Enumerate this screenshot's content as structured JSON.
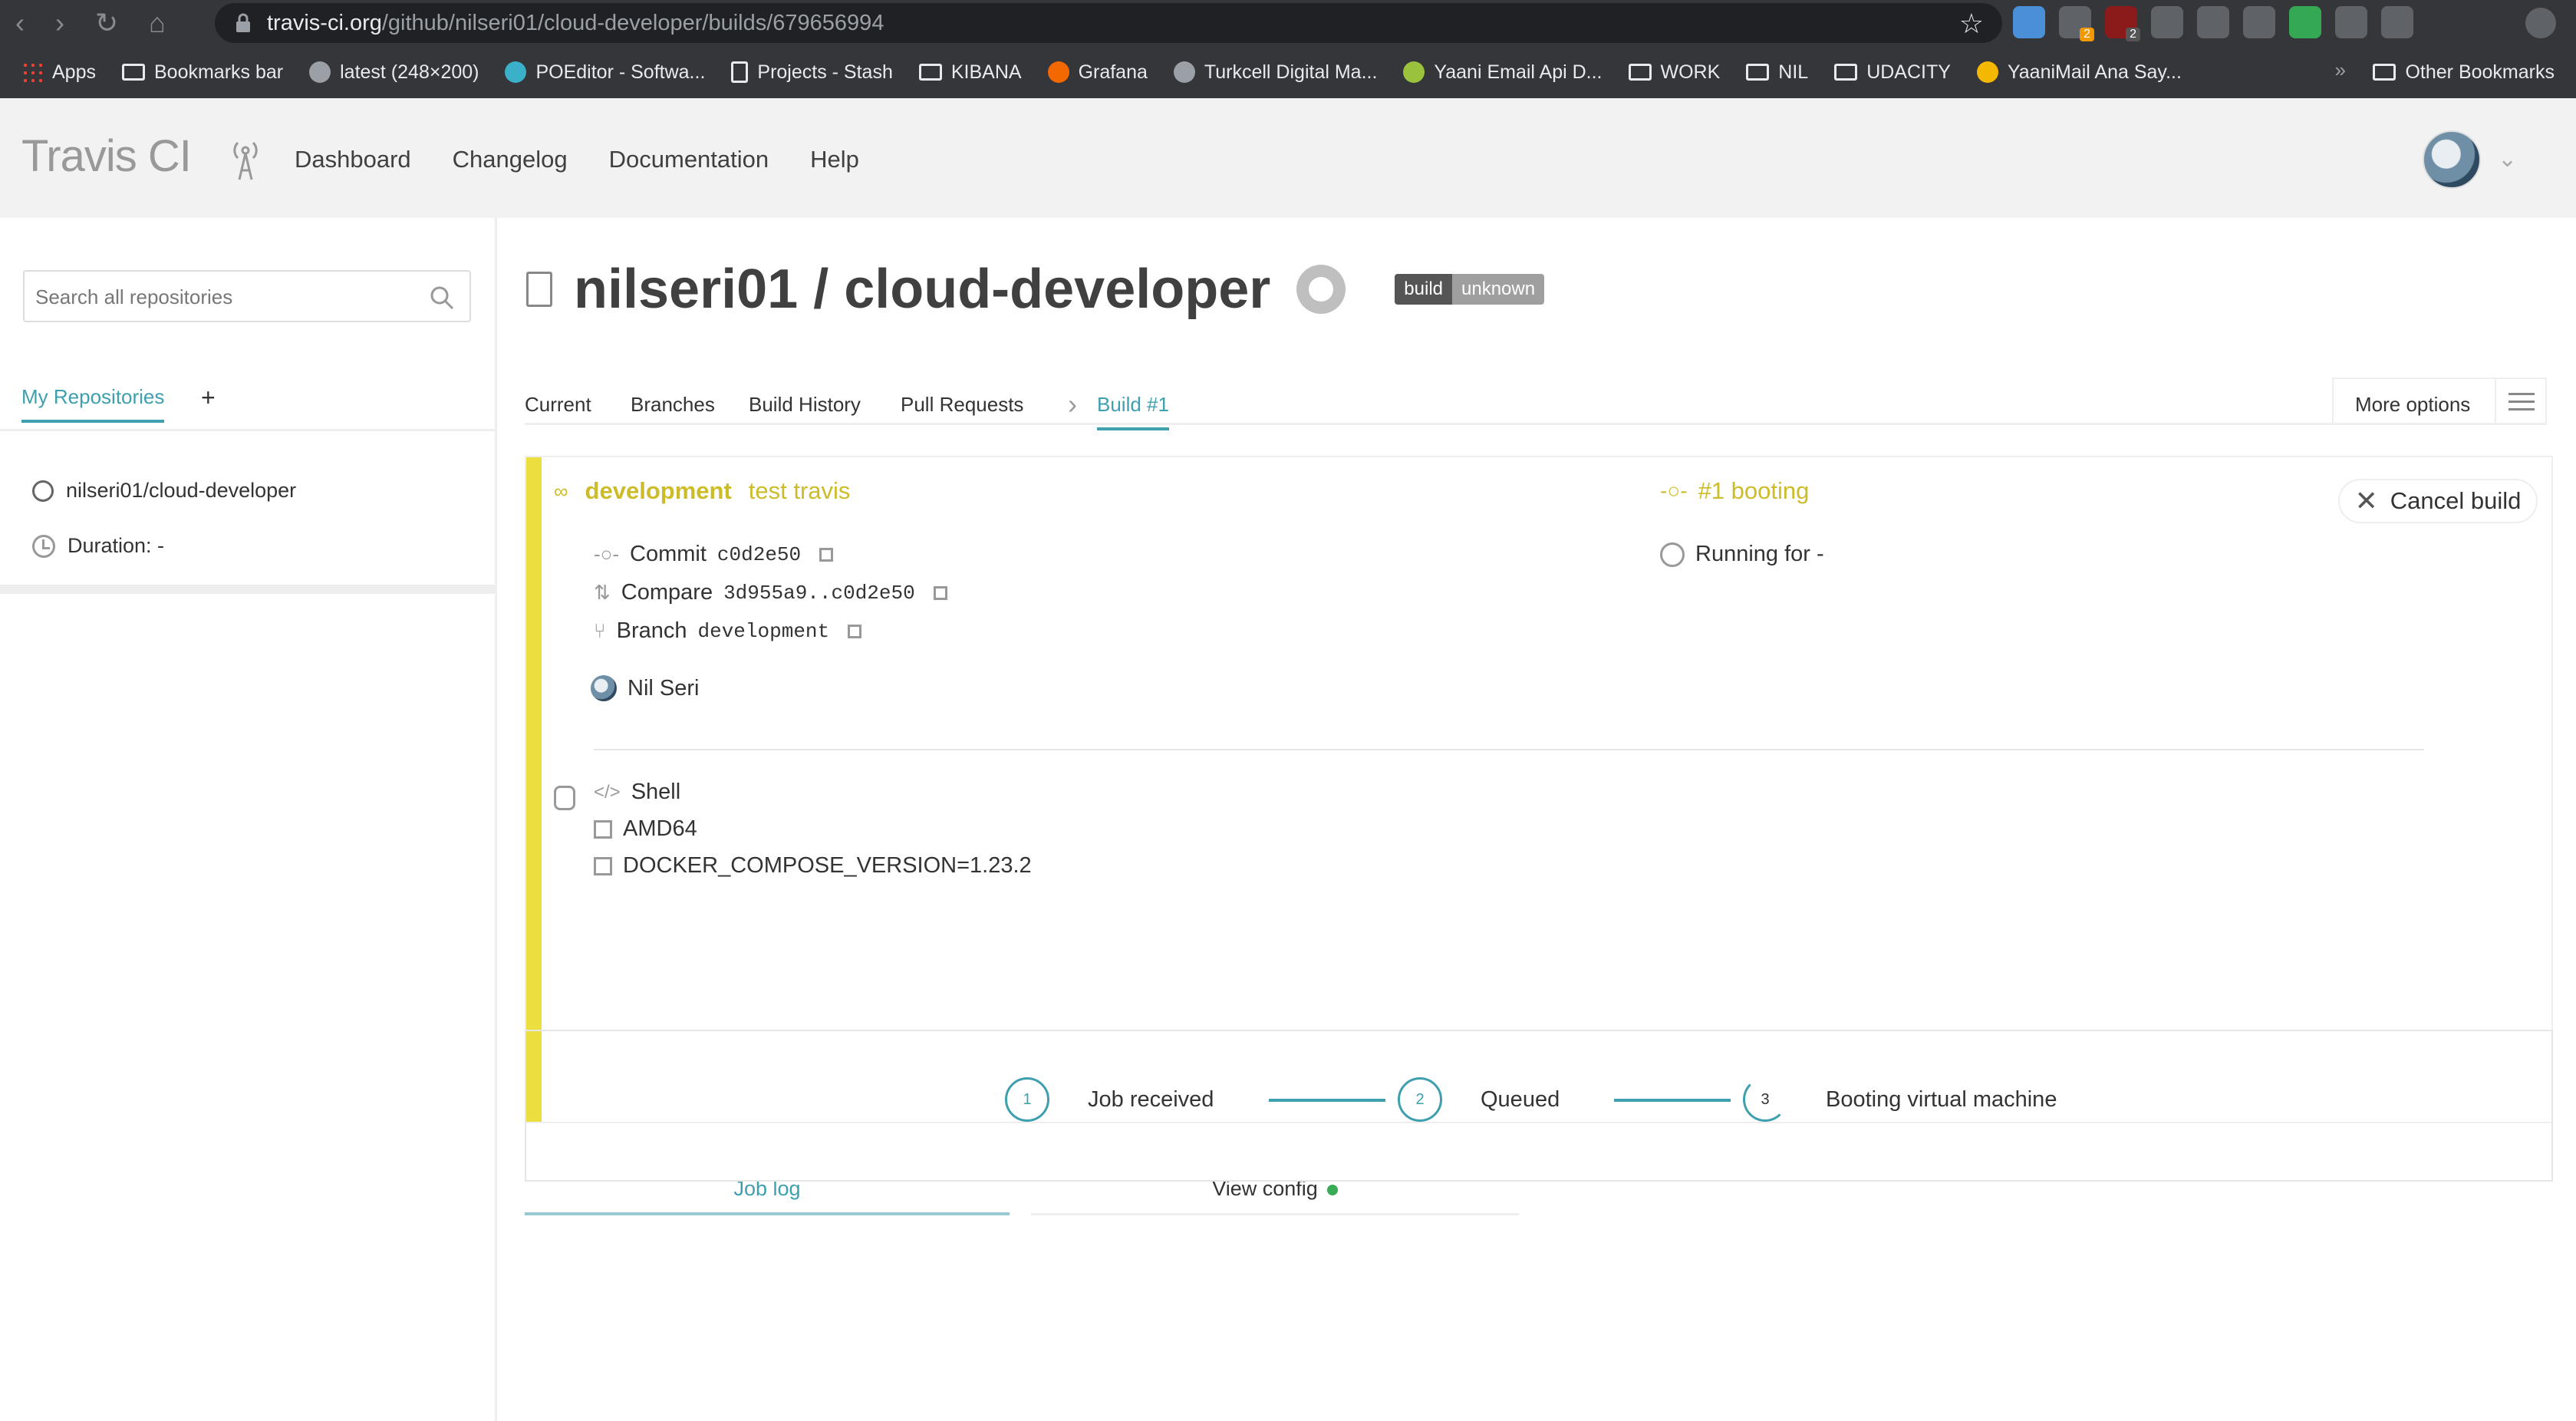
{
  "browser": {
    "url_host": "travis-ci.org",
    "url_path": "/github/nilseri01/cloud-developer/builds/679656994",
    "ext_badges": [
      "2",
      "2"
    ],
    "bookmarks": [
      {
        "label": "Apps",
        "icon": "apps-grid-icon"
      },
      {
        "label": "Bookmarks bar",
        "icon": "folder-icon"
      },
      {
        "label": "latest (248×200)",
        "icon": "globe-icon"
      },
      {
        "label": "POEditor - Softwa...",
        "icon": "poeditor-icon"
      },
      {
        "label": "Projects - Stash",
        "icon": "document-icon"
      },
      {
        "label": "KIBANA",
        "icon": "folder-icon"
      },
      {
        "label": "Grafana",
        "icon": "grafana-icon"
      },
      {
        "label": "Turkcell Digital Ma...",
        "icon": "globe-icon"
      },
      {
        "label": "Yaani Email Api D...",
        "icon": "yaani-icon"
      },
      {
        "label": "WORK",
        "icon": "folder-icon"
      },
      {
        "label": "NIL",
        "icon": "folder-icon"
      },
      {
        "label": "UDACITY",
        "icon": "folder-icon"
      },
      {
        "label": "YaaniMail Ana Say...",
        "icon": "yaani-icon"
      }
    ],
    "more_bookmarks": "»",
    "other_bookmarks": "Other Bookmarks"
  },
  "header": {
    "logo": "Travis CI",
    "nav": [
      "Dashboard",
      "Changelog",
      "Documentation",
      "Help"
    ]
  },
  "sidebar": {
    "search_placeholder": "Search all repositories",
    "tab_active": "My Repositories",
    "tab_add": "+",
    "repo_name": "nilseri01/cloud-developer",
    "duration": "Duration: -"
  },
  "repo": {
    "title": "nilseri01 / cloud-developer",
    "badge_left": "build",
    "badge_right": "unknown"
  },
  "tabs": {
    "items": [
      "Current",
      "Branches",
      "Build History",
      "Pull Requests",
      "Build #1"
    ],
    "more_options": "More options"
  },
  "build": {
    "branch": "development",
    "message": "test travis",
    "commit_label": "Commit",
    "commit_sha": "c0d2e50",
    "compare_label": "Compare",
    "compare_range": "3d955a9..c0d2e50",
    "branch_label": "Branch",
    "branch_code": "development",
    "author": "Nil Seri",
    "language": "Shell",
    "arch": "AMD64",
    "env": "DOCKER_COMPOSE_VERSION=1.23.2",
    "status": "#1 booting",
    "running": "Running for -",
    "cancel": "Cancel build"
  },
  "log": {
    "tab_job_log": "Job log",
    "tab_view_config": "View config",
    "steps": [
      {
        "num": "1",
        "label": "Job received"
      },
      {
        "num": "2",
        "label": "Queued"
      },
      {
        "num": "3",
        "label": "Booting virtual machine"
      }
    ]
  },
  "colors": {
    "accent": "#3ea0ae",
    "booting_yellow": "#cdbc2a",
    "stripe_yellow": "#edde3f",
    "config_ok_green": "#39aa56"
  }
}
